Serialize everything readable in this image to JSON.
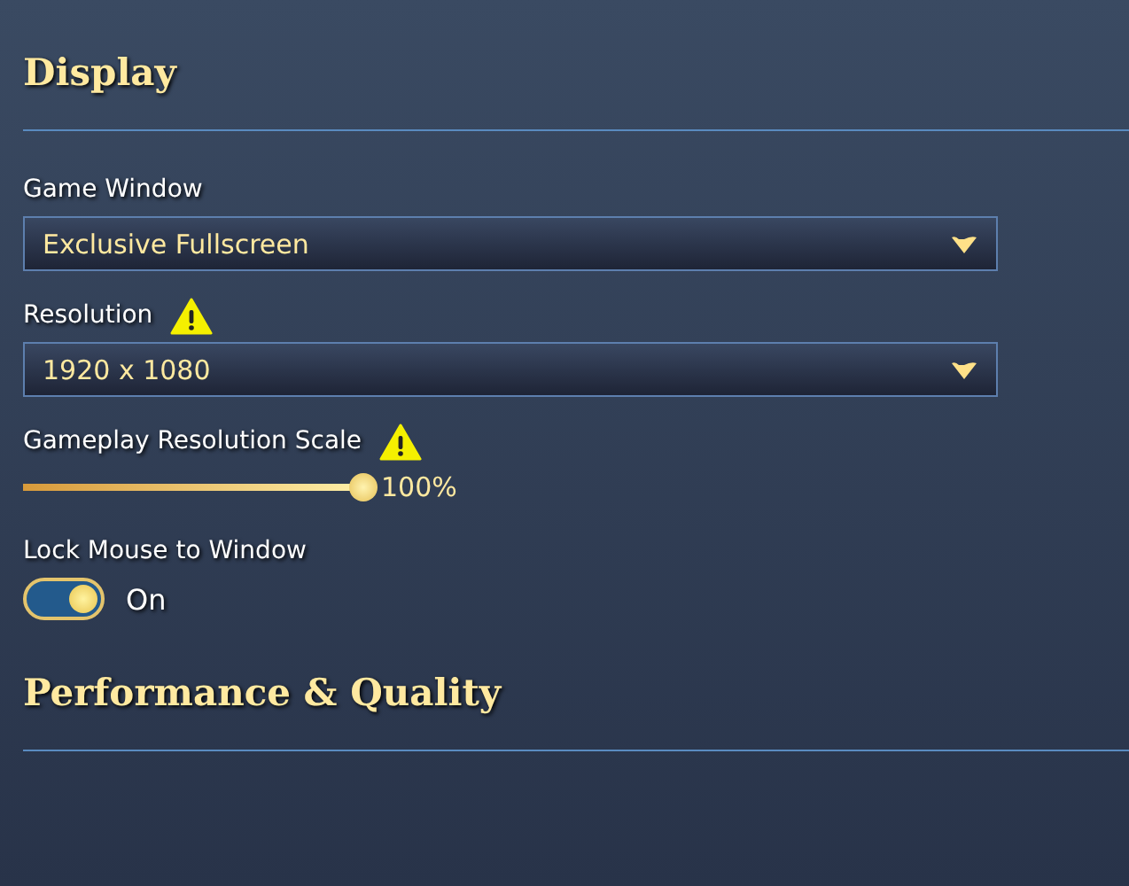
{
  "sections": [
    {
      "title": "Display",
      "settings": [
        {
          "kind": "dropdown",
          "label": "Game Window",
          "warning": false,
          "value": "Exclusive Fullscreen"
        },
        {
          "kind": "dropdown",
          "label": "Resolution",
          "warning": true,
          "value": "1920 x 1080"
        },
        {
          "kind": "slider",
          "label": "Gameplay Resolution Scale",
          "warning": true,
          "level": 1,
          "reading": "100%"
        },
        {
          "kind": "toggle",
          "label": "Lock Mouse to Window",
          "warning": false,
          "on": true,
          "state_text": "On"
        }
      ]
    },
    {
      "title": "Performance & Quality"
    }
  ]
}
